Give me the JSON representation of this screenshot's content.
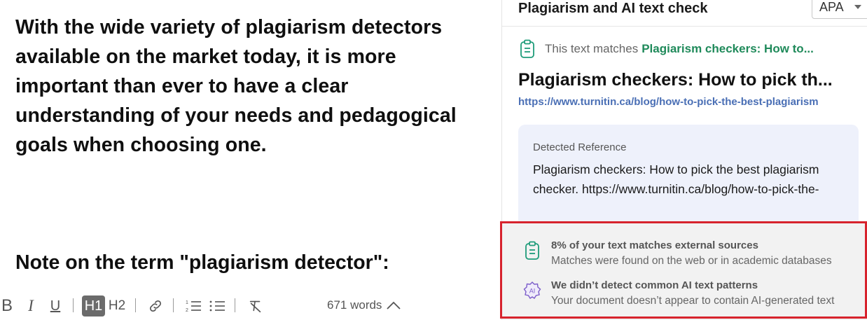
{
  "editor": {
    "paragraph": "With the wide variety of plagiarism detectors available on the market today, it is more important than ever to have a clear understanding of your needs and pedagogical goals when choosing one.",
    "heading": "Note on the term \"plagiarism detector\":",
    "toolbar": {
      "bold": "B",
      "italic": "I",
      "underline": "U",
      "h1": "H1",
      "h2": "H2",
      "word_count": "671 words"
    }
  },
  "panel": {
    "title": "Plagiarism and AI text check",
    "citation_style": "APA",
    "match_prefix": "This text matches",
    "match_source": "Plagiarism checkers: How to...",
    "source_title": "Plagiarism checkers: How to pick th...",
    "source_url": "https://www.turnitin.ca/blog/how-to-pick-the-best-plagiarism",
    "reference": {
      "label": "Detected Reference",
      "text": "Plagiarism checkers: How to pick the best plagiarism checker. https://www.turnitin.ca/blog/how-to-pick-the-"
    },
    "summary": {
      "plagiarism_title": "8% of your text matches external sources",
      "plagiarism_sub": "Matches were found on the web or in academic databases",
      "ai_title": "We didn’t detect common AI text patterns",
      "ai_sub": "Your document doesn’t appear to contain AI-generated text",
      "ai_badge": "AI"
    }
  },
  "colors": {
    "accent_green": "#1f8a5a",
    "link_blue": "#4a6fb5",
    "highlight_red": "#d7232d",
    "ai_purple": "#7b5cc9"
  }
}
